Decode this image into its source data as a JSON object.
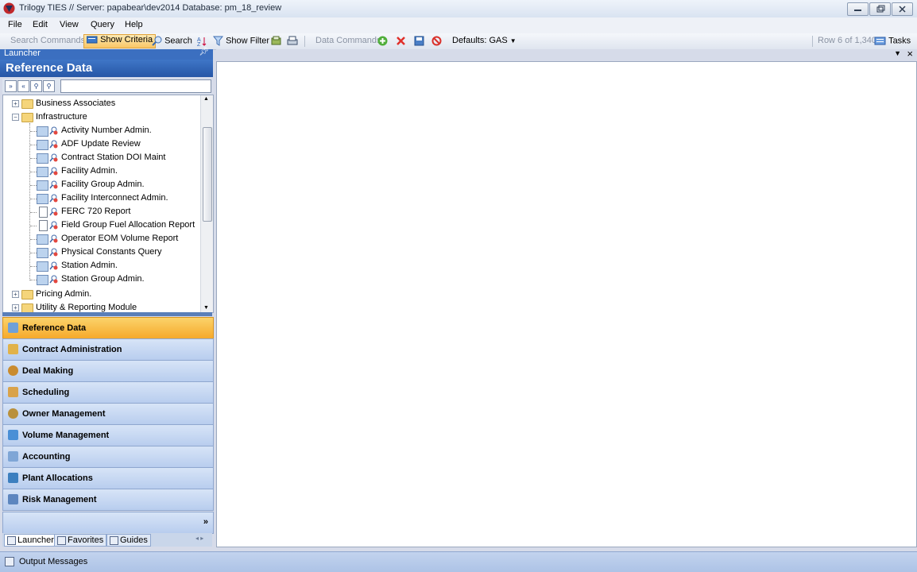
{
  "window": {
    "title": "Trilogy TIES //  Server: papabear\\dev2014 Database: pm_18_review"
  },
  "menu": {
    "items": [
      "File",
      "Edit",
      "View",
      "Query",
      "Help"
    ]
  },
  "toolbar": {
    "search_commands_label": "Search Commands:",
    "show_criteria_label": "Show Criteria",
    "search_label": "Search",
    "show_filter_label": "Show Filter",
    "data_commands_label": "Data Commands:",
    "defaults_label": "Defaults: GAS",
    "row_status": "Row 6 of 1,340",
    "tasks_label": "Tasks"
  },
  "launcher": {
    "header": "Launcher",
    "section_title": "Reference Data",
    "tree": {
      "top_folders": [
        "Business Associates",
        "Infrastructure"
      ],
      "children": [
        {
          "label": "Activity Number Admin.",
          "icon": "screen-icon"
        },
        {
          "label": "ADF Update Review",
          "icon": "screen-icon"
        },
        {
          "label": "Contract Station DOI Maint",
          "icon": "screen-icon"
        },
        {
          "label": "Facility Admin.",
          "icon": "screen-icon"
        },
        {
          "label": "Facility Group Admin.",
          "icon": "screen-icon"
        },
        {
          "label": "Facility Interconnect Admin.",
          "icon": "screen-icon"
        },
        {
          "label": "FERC 720 Report",
          "icon": "document-icon"
        },
        {
          "label": "Field Group Fuel Allocation Report",
          "icon": "document-icon"
        },
        {
          "label": "Operator EOM Volume Report",
          "icon": "screen-icon"
        },
        {
          "label": "Physical Constants Query",
          "icon": "screen-icon"
        },
        {
          "label": "Station Admin.",
          "icon": "screen-icon"
        },
        {
          "label": "Station Group Admin.",
          "icon": "screen-icon"
        }
      ],
      "bottom_folders": [
        "Pricing Admin.",
        "Utility & Reporting Module"
      ]
    },
    "nav_buttons": [
      {
        "label": "Reference Data",
        "active": true,
        "color": "#6fa0d8"
      },
      {
        "label": "Contract Administration",
        "active": false,
        "color": "#e1b24a"
      },
      {
        "label": "Deal Making",
        "active": false,
        "color": "#c98b2f"
      },
      {
        "label": "Scheduling",
        "active": false,
        "color": "#d9a34b"
      },
      {
        "label": "Owner Management",
        "active": false,
        "color": "#b9903c"
      },
      {
        "label": "Volume Management",
        "active": false,
        "color": "#4a8fd6"
      },
      {
        "label": "Accounting",
        "active": false,
        "color": "#7fa6d6"
      },
      {
        "label": "Plant Allocations",
        "active": false,
        "color": "#3c7fbf"
      },
      {
        "label": "Risk Management",
        "active": false,
        "color": "#5d86bf"
      }
    ],
    "bottom_tabs": [
      "Launcher",
      "Favorites",
      "Guides"
    ]
  },
  "status_bar": {
    "output_label": "Output Messages"
  }
}
